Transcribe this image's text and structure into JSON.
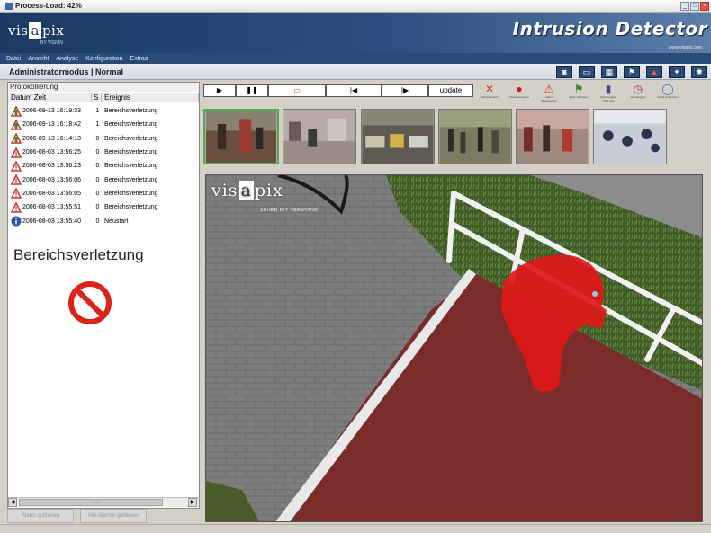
{
  "window": {
    "title": "Process-Load: 42%"
  },
  "banner": {
    "logo_left": "vis",
    "logo_dot": "a",
    "logo_right": "pix",
    "logo_sub": "BY VISION",
    "brand": "Intrusion Detector",
    "brand_url": "www.vitapix.com"
  },
  "menu": [
    "Datei",
    "Ansicht",
    "Analyse",
    "Konfiguration",
    "Extras"
  ],
  "mode": {
    "label": "Administratormodus | Normal"
  },
  "mode_tools": [
    "camera-icon",
    "monitor-icon",
    "grid-icon",
    "flag-icon",
    "warning-icon",
    "gear-icon",
    "cog-icon"
  ],
  "log": {
    "header": "Protokollierung",
    "columns": [
      "Datum Zeit",
      "S",
      "Ereignis"
    ],
    "rows": [
      {
        "icon": "person",
        "datetime": "2006-09-13 16:19:33",
        "s": "1",
        "event": "Bereichsverletzung"
      },
      {
        "icon": "person",
        "datetime": "2006-09-13 16:18:42",
        "s": "1",
        "event": "Bereichsverletzung"
      },
      {
        "icon": "person",
        "datetime": "2006-09-13 16:14:13",
        "s": "0",
        "event": "Bereichsverletzung"
      },
      {
        "icon": "warning",
        "datetime": "2006-08-03 13:56:25",
        "s": "0",
        "event": "Bereichsverletzung"
      },
      {
        "icon": "warning",
        "datetime": "2006-08-03 13:56:23",
        "s": "0",
        "event": "Bereichsverletzung"
      },
      {
        "icon": "warning",
        "datetime": "2006-08-03 13:56:06",
        "s": "0",
        "event": "Bereichsverletzung"
      },
      {
        "icon": "warning",
        "datetime": "2006-08-03 13:56:05",
        "s": "0",
        "event": "Bereichsverletzung"
      },
      {
        "icon": "warning",
        "datetime": "2006-08-03 13:55:51",
        "s": "0",
        "event": "Bereichsverletzung"
      },
      {
        "icon": "info",
        "datetime": "2006-08-03 13:55:40",
        "s": "0",
        "event": "Neustart"
      }
    ],
    "status_text": "Bereichsverletzung",
    "scroll_mid": "..."
  },
  "left_buttons": {
    "a": "Alarm quittieren",
    "b": "Alle Alarme quittieren"
  },
  "playback": {
    "play": "▶",
    "pause": "❚❚",
    "record": "▭",
    "prev": "|◀",
    "next": "|▶",
    "update": "update"
  },
  "tools": [
    {
      "glyph": "✕",
      "label": "Schreibschutz",
      "color": "#d0342c"
    },
    {
      "glyph": "●",
      "label": "Alarm ausgelöst",
      "color": "#b7241b"
    },
    {
      "glyph": "⚠",
      "label": "Alarm abgebrochen",
      "color": "#d23a2c"
    },
    {
      "glyph": "⚑",
      "label": "Ende Verfolgen",
      "color": "#3a8a2a"
    },
    {
      "glyph": "▮",
      "label": "Speicherplatz bald voll",
      "color": "#5a3a8a"
    },
    {
      "glyph": "◷",
      "label": "Alarmbeginn",
      "color": "#c4302a"
    },
    {
      "glyph": "◯",
      "label": "Unfall verbessern",
      "color": "#3a72c8"
    }
  ],
  "video": {
    "logo_left": "vis",
    "logo_dot": "a",
    "logo_right": "pix",
    "tagline": "SEHEN MIT VERSTAND"
  },
  "colors": {
    "banner": "#1b3a64",
    "detection": "#e01818",
    "accent": "#4caf50"
  }
}
